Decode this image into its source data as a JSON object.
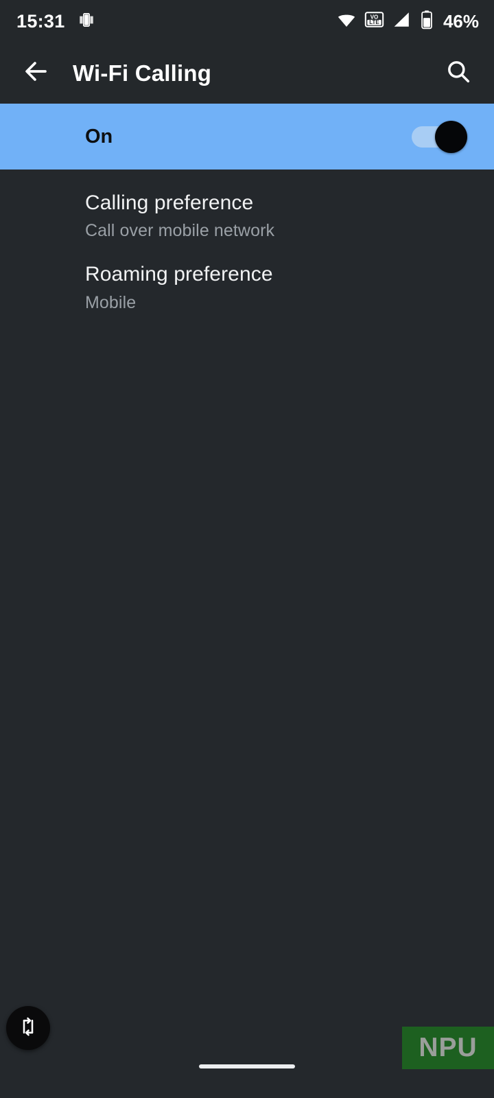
{
  "status_bar": {
    "clock": "15:31",
    "left_icons": [
      "screen-record-icon"
    ],
    "right_icons": [
      "wifi-icon",
      "volte-icon",
      "signal-icon",
      "battery-icon"
    ],
    "volte_top_text": "VO",
    "volte_bottom_text": "LTE",
    "battery_percent": "46%"
  },
  "app_bar": {
    "back_icon": "arrow-back-icon",
    "title": "Wi-Fi Calling",
    "search_icon": "search-icon"
  },
  "master_toggle": {
    "label": "On",
    "checked": true,
    "accent_color": "#71b1f7",
    "track_color": "#a8cdf4",
    "thumb_color": "#050608"
  },
  "preferences": [
    {
      "title": "Calling preference",
      "summary": "Call over mobile network"
    },
    {
      "title": "Roaming preference",
      "summary": "Mobile"
    }
  ],
  "floating_button": {
    "icon": "screen-rotation-icon"
  },
  "watermark": {
    "text": "NPU",
    "background_color": "#1d6020",
    "text_color": "#9a9e9a"
  },
  "navigation": {
    "gesture_pill": "home-indicator"
  },
  "theme": {
    "background": "#24282c",
    "app_bar_background": "#24282b",
    "primary_text": "#f1f2f3",
    "secondary_text": "#9aa0a6"
  }
}
